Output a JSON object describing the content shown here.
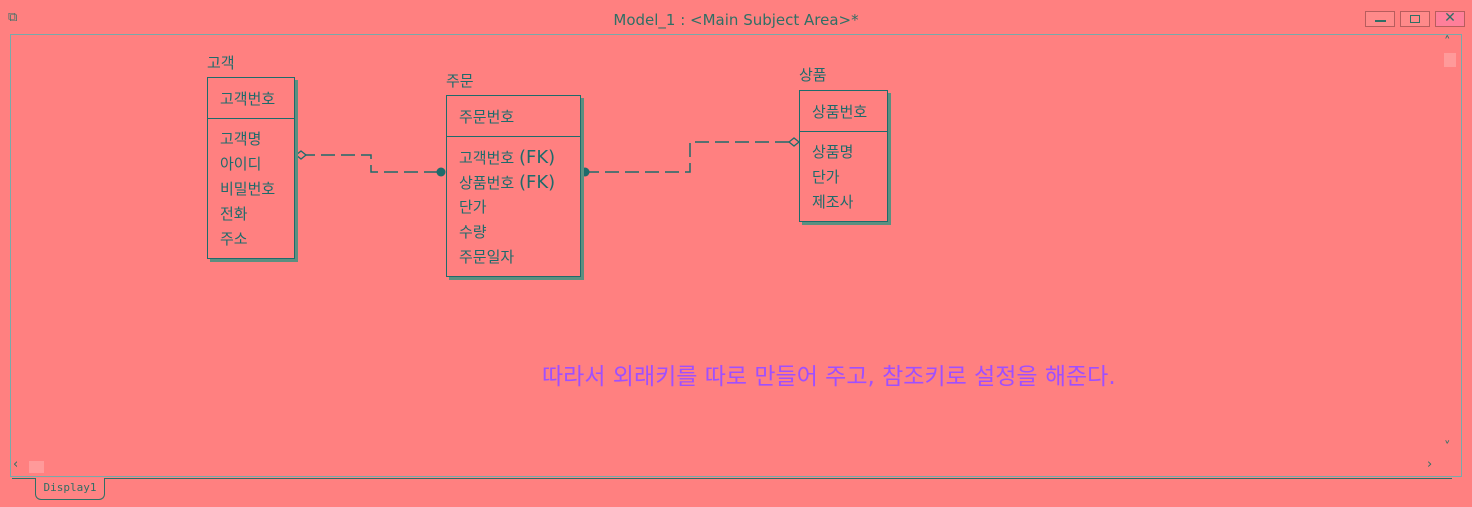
{
  "window": {
    "title": "Model_1 : <Main Subject Area>*",
    "app_icon": "model-icon"
  },
  "entities": [
    {
      "name": "고객",
      "pk": "고객번호",
      "attributes": [
        "고객명",
        "아이디",
        "비밀번호",
        "전화",
        "주소"
      ]
    },
    {
      "name": "주문",
      "pk": "주문번호",
      "attributes": [
        {
          "text": "고객번호",
          "suffix": "(FK)"
        },
        {
          "text": "상품번호",
          "suffix": "(FK)"
        },
        {
          "text": "단가",
          "suffix": ""
        },
        {
          "text": "수량",
          "suffix": ""
        },
        {
          "text": "주문일자",
          "suffix": ""
        }
      ]
    },
    {
      "name": "상품",
      "pk": "상품번호",
      "attributes": [
        "상품명",
        "단가",
        "제조사"
      ]
    }
  ],
  "note": "따라서 외래키를 따로 만들어 주고, 참조키로 설정을 해준다.",
  "tabs": [
    "Display1"
  ],
  "colors": {
    "background": "#ff8080",
    "entity_line": "#1e6b6b",
    "note_text": "#9f4fff"
  }
}
